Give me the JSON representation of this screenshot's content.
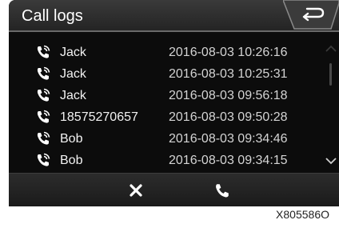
{
  "header": {
    "title": "Call logs",
    "back_icon": "back-arrow-icon"
  },
  "calls": [
    {
      "name": "Jack",
      "time": "2016-08-03 10:26:16",
      "icon": "phone-call-icon"
    },
    {
      "name": "Jack",
      "time": "2016-08-03 10:25:31",
      "icon": "phone-call-icon"
    },
    {
      "name": "Jack",
      "time": "2016-08-03 09:56:18",
      "icon": "phone-call-icon"
    },
    {
      "name": "18575270657",
      "time": "2016-08-03 09:50:28",
      "icon": "phone-call-icon"
    },
    {
      "name": "Bob",
      "time": "2016-08-03 09:34:46",
      "icon": "phone-call-icon"
    },
    {
      "name": "Bob",
      "time": "2016-08-03 09:34:15",
      "icon": "phone-call-icon"
    }
  ],
  "toolbar": {
    "delete_icon": "close-icon",
    "call_icon": "phone-icon"
  },
  "figure_code": "X805586O",
  "colors": {
    "background": "#0c0c0c",
    "header": "#2e2e2e",
    "text": "#f2f2f2"
  }
}
